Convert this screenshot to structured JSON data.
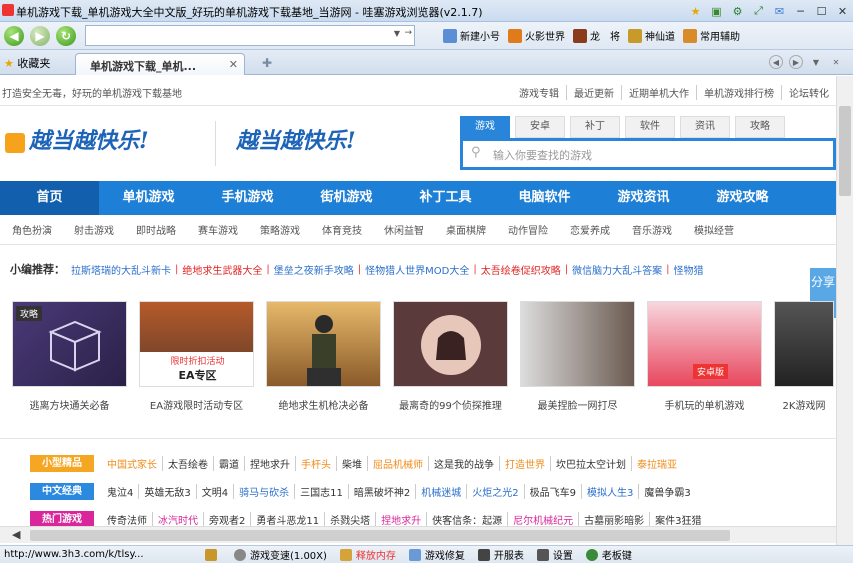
{
  "window": {
    "title": "单机游戏下载_单机游戏大全中文版_好玩的单机游戏下载基地_当游网 - 哇塞游戏浏览器(v2.1.7)"
  },
  "nav": {
    "address": "",
    "tools": [
      "新建小号",
      "火影世界",
      "龙　将",
      "神仙道",
      "常用辅助"
    ]
  },
  "tabs": {
    "favorites": "收藏夹",
    "active": "单机游戏下载_单机..."
  },
  "page": {
    "slogan": "打造安全无毒，好玩的单机游戏下载基地",
    "toplinks": [
      "游戏专辑",
      "最近更新",
      "近期单机大作",
      "单机游戏排行榜",
      "论坛转化"
    ],
    "logo_text": "越当越快乐!",
    "search": {
      "tabs": [
        "游戏",
        "安卓",
        "补丁",
        "软件",
        "资讯",
        "攻略"
      ],
      "placeholder": "输入你要查找的游戏"
    },
    "mainnav": [
      "首页",
      "单机游戏",
      "手机游戏",
      "街机游戏",
      "补丁工具",
      "电脑软件",
      "游戏资讯",
      "游戏攻略"
    ],
    "subnav": [
      "角色扮演",
      "射击游戏",
      "即时战略",
      "赛车游戏",
      "策略游戏",
      "体育竞技",
      "休闲益智",
      "桌面棋牌",
      "动作冒险",
      "恋爱养成",
      "音乐游戏",
      "模拟经营"
    ],
    "rec": {
      "label": "小编推荐：",
      "items": [
        {
          "text": "拉斯塔瑞的大乱斗新卡",
          "color": "#2b6fcb"
        },
        {
          "text": "绝地求生武器大全",
          "color": "#e02424"
        },
        {
          "text": "堡垒之夜新手攻略",
          "color": "#2b6fcb"
        },
        {
          "text": "怪物猎人世界MOD大全",
          "color": "#2b6fcb"
        },
        {
          "text": "太吾绘卷促织攻略",
          "color": "#e02424"
        },
        {
          "text": "微信脑力大乱斗答案",
          "color": "#2b6fcb"
        },
        {
          "text": "怪物猎",
          "color": "#2b6fcb"
        }
      ]
    },
    "share": "分享",
    "cards": [
      {
        "caption": "逃离方块通关必备",
        "badge": "攻略"
      },
      {
        "caption": "EA游戏限时活动专区",
        "overlay1": "限时折扣活动",
        "overlay2": "EA专区"
      },
      {
        "caption": "绝地求生机枪决必备"
      },
      {
        "caption": "最离奇的99个侦探推理"
      },
      {
        "caption": "最美捏脸一网打尽"
      },
      {
        "caption": "手机玩的单机游戏",
        "overlay1": "安卓版"
      },
      {
        "caption": "2K游戏网"
      }
    ],
    "rows": [
      {
        "tag": "小型精品",
        "tag_color": "#f5a623",
        "games": [
          {
            "t": "中国式家长",
            "c": "#f08b1a"
          },
          {
            "t": "太吾绘卷",
            "c": "#333"
          },
          {
            "t": "霸道",
            "c": "#333"
          },
          {
            "t": "捏地求升",
            "c": "#333"
          },
          {
            "t": "手杆头",
            "c": "#f08b1a"
          },
          {
            "t": "柴堆",
            "c": "#333"
          },
          {
            "t": "屈品机械师",
            "c": "#f08b1a"
          },
          {
            "t": "这是我的战争",
            "c": "#333"
          },
          {
            "t": "打造世界",
            "c": "#f08b1a"
          },
          {
            "t": "坎巴拉太空计划",
            "c": "#333"
          },
          {
            "t": "泰拉瑞亚",
            "c": "#f08b1a"
          }
        ]
      },
      {
        "tag": "中文经典",
        "tag_color": "#2b8ae0",
        "games": [
          {
            "t": "鬼泣4",
            "c": "#333"
          },
          {
            "t": "英雄无敌3",
            "c": "#333"
          },
          {
            "t": "文明4",
            "c": "#333"
          },
          {
            "t": "骑马与砍杀",
            "c": "#2b6fcb"
          },
          {
            "t": "三国志11",
            "c": "#333"
          },
          {
            "t": "暗黑破坏神2",
            "c": "#333"
          },
          {
            "t": "机械迷城",
            "c": "#2b6fcb"
          },
          {
            "t": "火炬之光2",
            "c": "#2b6fcb"
          },
          {
            "t": "极品飞车9",
            "c": "#333"
          },
          {
            "t": "模拟人生3",
            "c": "#2b6fcb"
          },
          {
            "t": "魔兽争霸3",
            "c": "#333"
          }
        ]
      },
      {
        "tag": "热门游戏",
        "tag_color": "#d9269b",
        "games": [
          {
            "t": "传奇法师",
            "c": "#333"
          },
          {
            "t": "冰汽时代",
            "c": "#d9269b"
          },
          {
            "t": "旁观者2",
            "c": "#333"
          },
          {
            "t": "勇者斗恶龙11",
            "c": "#333"
          },
          {
            "t": "杀戮尖塔",
            "c": "#333"
          },
          {
            "t": "捏地求升",
            "c": "#d9269b"
          },
          {
            "t": "侠客信条：起源",
            "c": "#333"
          },
          {
            "t": "尼尔机械纪元",
            "c": "#d9269b"
          },
          {
            "t": "古墓丽影暗影",
            "c": "#333"
          },
          {
            "t": "案件3狂猎",
            "c": "#333"
          }
        ]
      }
    ]
  },
  "status": {
    "url": "http://www.3h3.com/k/tlsy...",
    "items": [
      "游戏变速(1.00X)",
      "释放内存",
      "游戏修复",
      "开服表",
      "设置",
      "老板键"
    ],
    "accent": "#e33"
  }
}
